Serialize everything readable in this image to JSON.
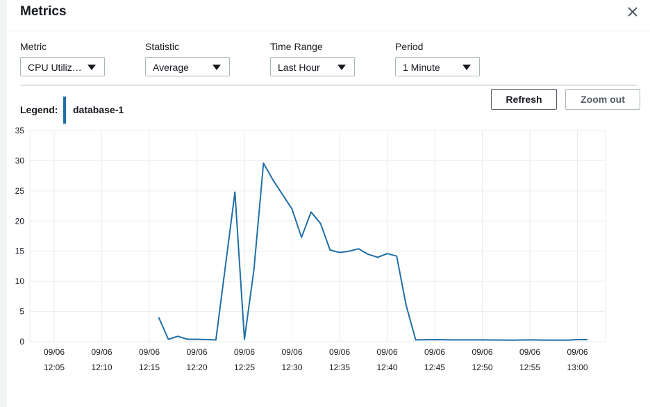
{
  "modal": {
    "title": "Metrics",
    "close_icon": "close-icon"
  },
  "controls": {
    "metric": {
      "label": "Metric",
      "value": "CPU Utiliz…"
    },
    "statistic": {
      "label": "Statistic",
      "value": "Average"
    },
    "time_range": {
      "label": "Time Range",
      "value": "Last Hour"
    },
    "period": {
      "label": "Period",
      "value": "1 Minute"
    }
  },
  "buttons": {
    "refresh": "Refresh",
    "zoom_out": "Zoom out"
  },
  "legend": {
    "label": "Legend:",
    "series_name": "database-1",
    "series_color": "#1f6fa6"
  },
  "chart_data": {
    "type": "line",
    "title": "",
    "xlabel": "",
    "ylabel": "",
    "ylim": [
      0,
      35
    ],
    "yticks": [
      0,
      5,
      10,
      15,
      20,
      25,
      30,
      35
    ],
    "grid": true,
    "x_tick_labels": [
      {
        "date": "09/06",
        "time": "12:05"
      },
      {
        "date": "09/06",
        "time": "12:10"
      },
      {
        "date": "09/06",
        "time": "12:15"
      },
      {
        "date": "09/06",
        "time": "12:20"
      },
      {
        "date": "09/06",
        "time": "12:25"
      },
      {
        "date": "09/06",
        "time": "12:30"
      },
      {
        "date": "09/06",
        "time": "12:35"
      },
      {
        "date": "09/06",
        "time": "12:40"
      },
      {
        "date": "09/06",
        "time": "12:45"
      },
      {
        "date": "09/06",
        "time": "12:50"
      },
      {
        "date": "09/06",
        "time": "12:55"
      },
      {
        "date": "09/06",
        "time": "13:00"
      }
    ],
    "series": [
      {
        "name": "database-1",
        "color": "#1f6fa6",
        "points": [
          [
            "12:16",
            4.0
          ],
          [
            "12:17",
            0.4
          ],
          [
            "12:18",
            0.9
          ],
          [
            "12:19",
            0.4
          ],
          [
            "12:20",
            0.4
          ],
          [
            "12:22",
            0.3
          ],
          [
            "12:24",
            24.8
          ],
          [
            "12:25",
            0.4
          ],
          [
            "12:26",
            12.0
          ],
          [
            "12:27",
            29.6
          ],
          [
            "12:28",
            26.8
          ],
          [
            "12:30",
            22.0
          ],
          [
            "12:31",
            17.3
          ],
          [
            "12:32",
            21.5
          ],
          [
            "12:33",
            19.6
          ],
          [
            "12:34",
            15.2
          ],
          [
            "12:35",
            14.8
          ],
          [
            "12:36",
            15.0
          ],
          [
            "12:37",
            15.4
          ],
          [
            "12:38",
            14.5
          ],
          [
            "12:39",
            14.0
          ],
          [
            "12:40",
            14.6
          ],
          [
            "12:41",
            14.2
          ],
          [
            "12:42",
            6.0
          ],
          [
            "12:43",
            0.3
          ],
          [
            "12:45",
            0.35
          ],
          [
            "12:47",
            0.3
          ],
          [
            "12:50",
            0.3
          ],
          [
            "12:53",
            0.25
          ],
          [
            "12:55",
            0.3
          ],
          [
            "12:57",
            0.25
          ],
          [
            "12:59",
            0.25
          ],
          [
            "13:00",
            0.35
          ],
          [
            "13:01",
            0.35
          ]
        ]
      }
    ]
  }
}
